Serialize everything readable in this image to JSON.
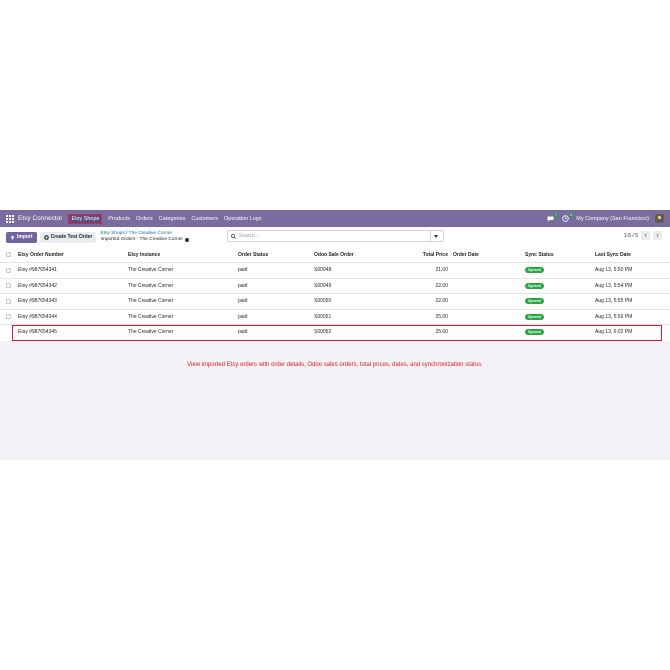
{
  "navbar": {
    "brand": "Etsy Connector",
    "items": [
      "Etsy Shops",
      "Products",
      "Orders",
      "Categories",
      "Customers",
      "Operation Logs"
    ],
    "active_item": "Etsy Shops",
    "chat_badge": "7",
    "activity_badge": "4",
    "company": "My Company (San Francisco)"
  },
  "control": {
    "import_label": "Import",
    "create_test_label": "Create Test Order",
    "breadcrumb_parent": "Etsy Shops",
    "breadcrumb_sep": "/",
    "breadcrumb_shop": "The Creative Corner",
    "breadcrumb_current": "Imported Orders - The Creative Corner",
    "search_placeholder": "Search...",
    "pager": "1-5 / 5"
  },
  "table": {
    "headers": {
      "order_number": "Etsy Order Number",
      "instance": "Etsy Instance",
      "order_status": "Order Status",
      "sale_order": "Odoo Sale Order",
      "total_price": "Total Price",
      "order_date": "Order Date",
      "sync_status": "Sync Status",
      "last_sync": "Last Sync Date"
    },
    "rows": [
      {
        "order_number": "Etsy #987654341",
        "instance": "The Creative Corner",
        "order_status": "paid",
        "sale_order": "S00048",
        "total_price": "21.00",
        "order_date": "",
        "sync_status": "Synced",
        "last_sync": "Aug 13, 5:50 PM"
      },
      {
        "order_number": "Etsy #987654342",
        "instance": "The Creative Corner",
        "order_status": "paid",
        "sale_order": "S00049",
        "total_price": "22.00",
        "order_date": "",
        "sync_status": "Synced",
        "last_sync": "Aug 13, 5:54 PM"
      },
      {
        "order_number": "Etsy #987654343",
        "instance": "The Creative Corner",
        "order_status": "paid",
        "sale_order": "S00050",
        "total_price": "22.00",
        "order_date": "",
        "sync_status": "Synced",
        "last_sync": "Aug 13, 5:55 PM"
      },
      {
        "order_number": "Etsy #987654344",
        "instance": "The Creative Corner",
        "order_status": "paid",
        "sale_order": "S00051",
        "total_price": "25.00",
        "order_date": "",
        "sync_status": "Synced",
        "last_sync": "Aug 13, 5:56 PM"
      },
      {
        "order_number": "Etsy #987654345",
        "instance": "The Creative Corner",
        "order_status": "paid",
        "sale_order": "S00052",
        "total_price": "25.00",
        "order_date": "",
        "sync_status": "Synced",
        "last_sync": "Aug 13, 6:02 PM"
      }
    ]
  },
  "caption": "View imported Etsy orders with order details, Odoo sales orders, total prices, dates, and synchronization status.",
  "colors": {
    "navbar": "#7a6c9e",
    "primary": "#71639e",
    "synced": "#28a745",
    "highlight": "#e0182b"
  }
}
